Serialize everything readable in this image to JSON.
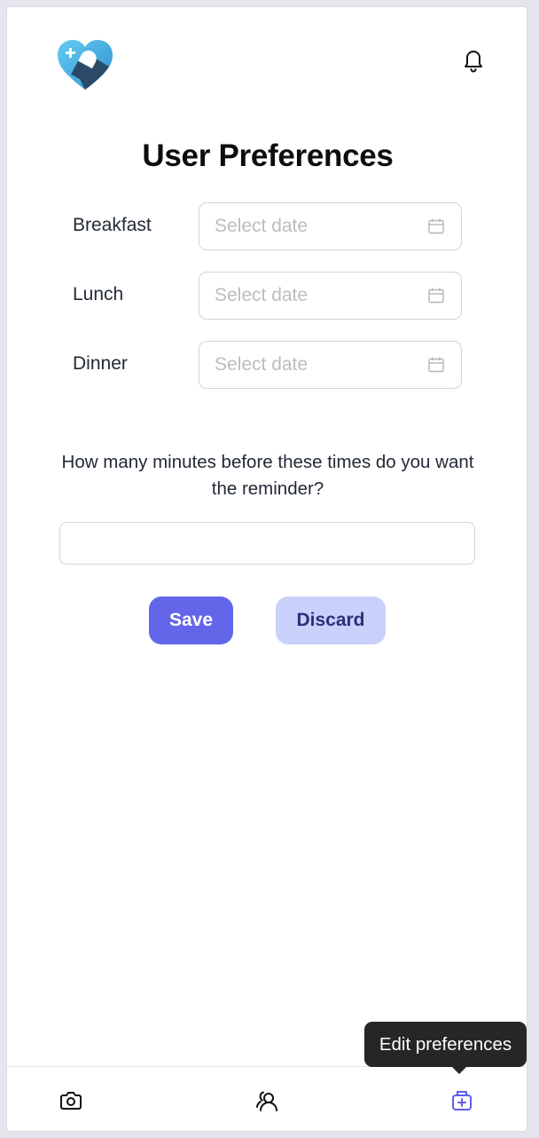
{
  "header": {
    "logo_icon": "heart-pill-logo",
    "notification_icon": "bell-icon"
  },
  "page": {
    "title": "User Preferences"
  },
  "meals": [
    {
      "label": "Breakfast",
      "placeholder": "Select date",
      "icon": "calendar-icon"
    },
    {
      "label": "Lunch",
      "placeholder": "Select date",
      "icon": "calendar-icon"
    },
    {
      "label": "Dinner",
      "placeholder": "Select date",
      "icon": "calendar-icon"
    }
  ],
  "reminder": {
    "question": "How many minutes before these times do you want the reminder?",
    "value": ""
  },
  "actions": {
    "save_label": "Save",
    "discard_label": "Discard"
  },
  "tooltip": {
    "text": "Edit preferences"
  },
  "bottom_nav": {
    "items": [
      {
        "icon": "camera-icon",
        "active": false
      },
      {
        "icon": "user-group-icon",
        "active": false
      },
      {
        "icon": "medical-kit-icon",
        "active": true
      }
    ]
  },
  "colors": {
    "accent": "#6366e8",
    "accent_light": "#c8d1fa",
    "accent_text_dark": "#2a3179",
    "logo_light_blue": "#5bc2ee",
    "logo_dark_blue": "#2a4a6a",
    "tooltip_bg": "#262626"
  }
}
